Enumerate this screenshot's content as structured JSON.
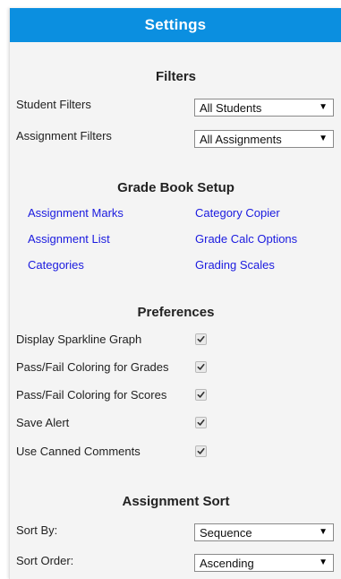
{
  "header": {
    "title": "Settings"
  },
  "filters": {
    "title": "Filters",
    "student_label": "Student Filters",
    "student_value": "All Students",
    "assignment_label": "Assignment Filters",
    "assignment_value": "All Assignments"
  },
  "gradebook": {
    "title": "Grade Book Setup",
    "links": [
      "Assignment Marks",
      "Category Copier",
      "Assignment List",
      "Grade Calc Options",
      "Categories",
      "Grading Scales"
    ]
  },
  "preferences": {
    "title": "Preferences",
    "items": [
      {
        "label": "Display Sparkline Graph",
        "checked": true
      },
      {
        "label": "Pass/Fail Coloring for Grades",
        "checked": true
      },
      {
        "label": "Pass/Fail Coloring for Scores",
        "checked": true
      },
      {
        "label": "Save Alert",
        "checked": true
      },
      {
        "label": "Use Canned Comments",
        "checked": true
      }
    ]
  },
  "sort": {
    "title": "Assignment Sort",
    "sort_by_label": "Sort By:",
    "sort_by_value": "Sequence",
    "sort_order_label": "Sort Order:",
    "sort_order_value": "Ascending"
  },
  "icons": {
    "dropdown": "triangle-down-icon",
    "check": "checkmark-icon"
  },
  "colors": {
    "header_bg": "#0b8fe0",
    "link": "#1a1adf"
  }
}
